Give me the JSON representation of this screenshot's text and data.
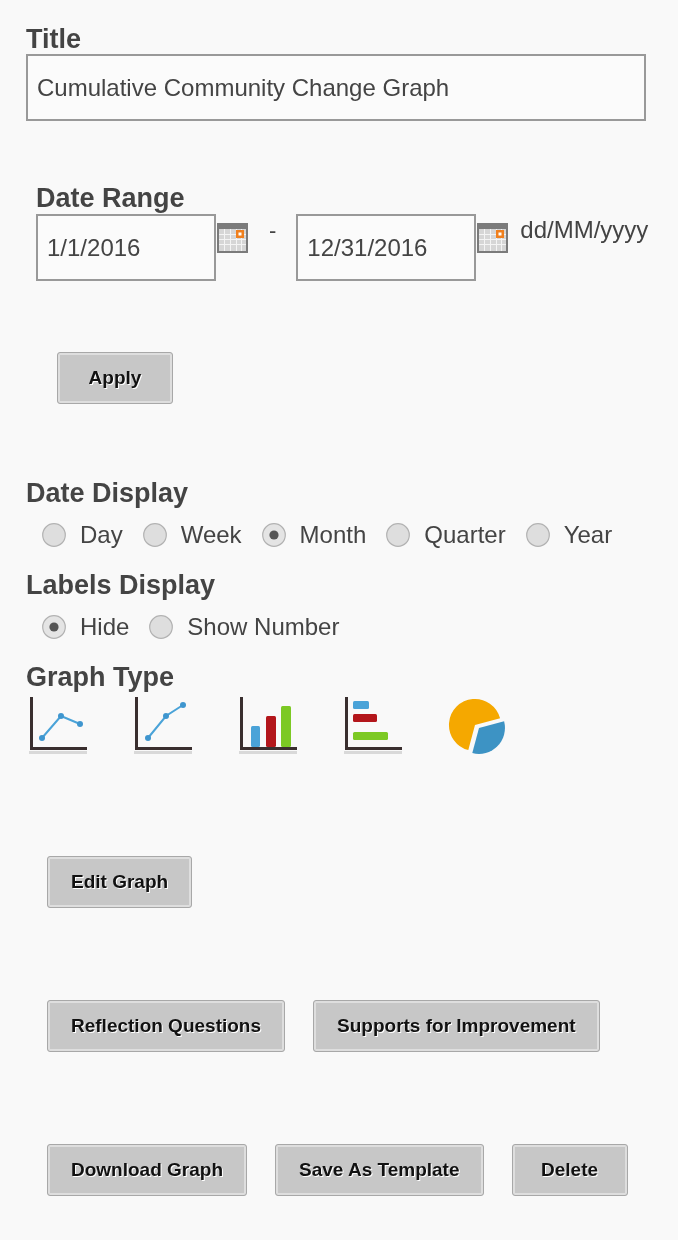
{
  "title": {
    "label": "Title",
    "value": "Cumulative Community Change Graph"
  },
  "date_range": {
    "label": "Date Range",
    "start": "1/1/2016",
    "separator": "-",
    "end": "12/31/2016",
    "format": "dd/MM/yyyy"
  },
  "apply_button": {
    "label": "Apply"
  },
  "date_display": {
    "label": "Date Display",
    "options": [
      {
        "label": "Day",
        "selected": false
      },
      {
        "label": "Week",
        "selected": false
      },
      {
        "label": "Month",
        "selected": true
      },
      {
        "label": "Quarter",
        "selected": false
      },
      {
        "label": "Year",
        "selected": false
      }
    ]
  },
  "labels_display": {
    "label": "Labels Display",
    "options": [
      {
        "label": "Hide",
        "selected": true
      },
      {
        "label": "Show Number",
        "selected": false
      }
    ]
  },
  "graph_type": {
    "label": "Graph Type",
    "options": [
      {
        "kind": "line"
      },
      {
        "kind": "trend"
      },
      {
        "kind": "column"
      },
      {
        "kind": "bar"
      },
      {
        "kind": "pie"
      }
    ]
  },
  "button_rows": [
    [
      "Edit Graph"
    ],
    [
      "Reflection Questions",
      "Supports for Improvement"
    ],
    [
      "Download Graph",
      "Save As Template",
      "Delete"
    ]
  ]
}
